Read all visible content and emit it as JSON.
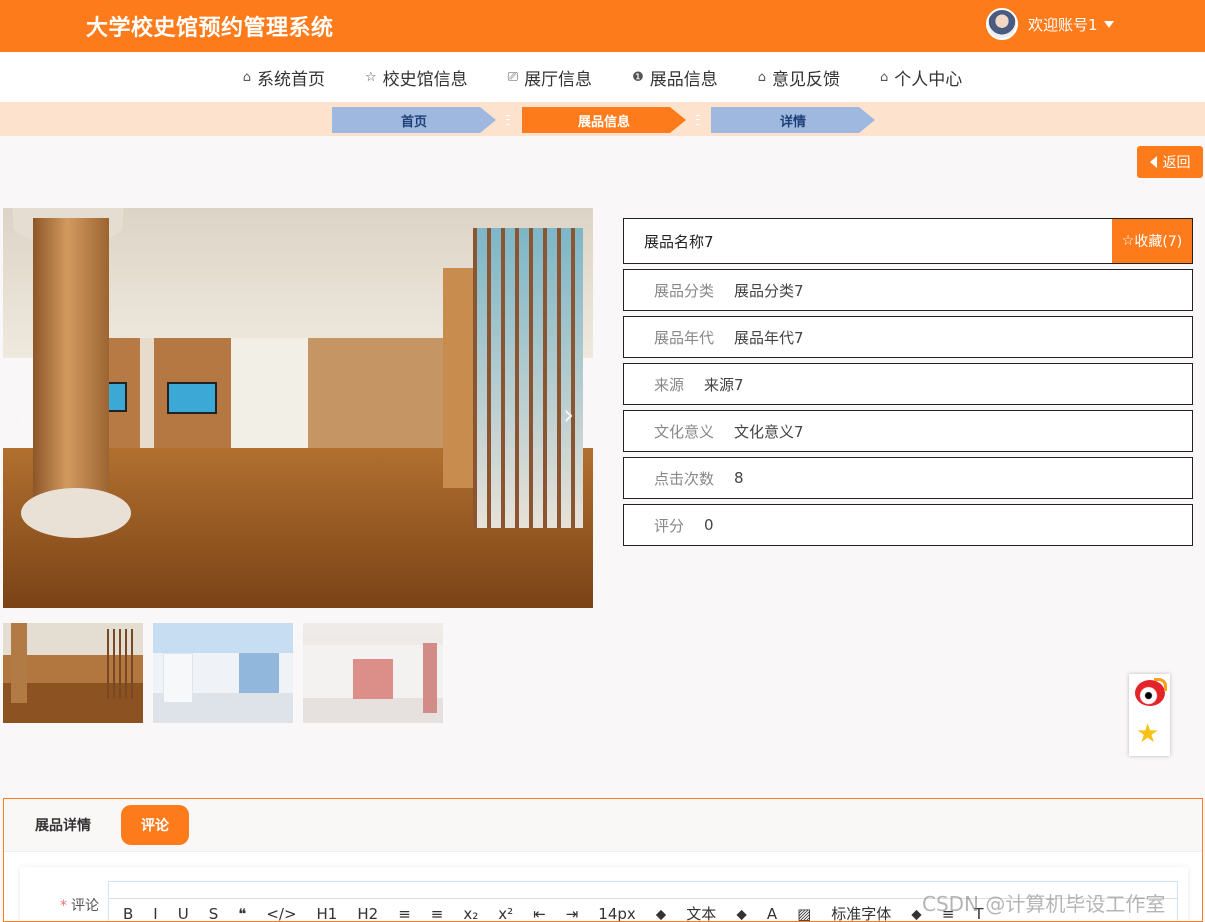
{
  "header": {
    "title": "大学校史馆预约管理系统",
    "welcome": "欢迎账号1"
  },
  "nav": [
    {
      "icon": "home-icon",
      "glyph": "⌂",
      "label": "系统首页"
    },
    {
      "icon": "star-icon",
      "glyph": "☆",
      "label": "校史馆信息"
    },
    {
      "icon": "bag-icon",
      "glyph": "⎚",
      "label": "展厅信息"
    },
    {
      "icon": "info-icon",
      "glyph": "❶",
      "label": "展品信息"
    },
    {
      "icon": "home-icon",
      "glyph": "⌂",
      "label": "意见反馈"
    },
    {
      "icon": "home-icon",
      "glyph": "⌂",
      "label": "个人中心"
    }
  ],
  "breadcrumb": [
    "首页",
    "展品信息",
    "详情"
  ],
  "back_label": "返回",
  "carousel": {
    "prev": "‹",
    "next": "›"
  },
  "exhibit": {
    "name": "展品名称7",
    "favorite_label": "收藏(7)",
    "fields": [
      {
        "label": "展品分类",
        "value": "展品分类7"
      },
      {
        "label": "展品年代",
        "value": "展品年代7"
      },
      {
        "label": "来源",
        "value": "来源7"
      },
      {
        "label": "文化意义",
        "value": "文化意义7"
      },
      {
        "label": "点击次数",
        "value": "8"
      },
      {
        "label": "评分",
        "value": "0"
      }
    ]
  },
  "tabs": {
    "detail": "展品详情",
    "comment": "评论"
  },
  "comment_form": {
    "required_mark": "*",
    "label": "评论",
    "toolbar": [
      "B",
      "I",
      "U",
      "S",
      "❝",
      "</>",
      "H1",
      "H2",
      "≡",
      "≡",
      "x₂",
      "x²",
      "⇤",
      "⇥",
      "14px",
      "⬥",
      "文本",
      "⬥",
      "A",
      "▨",
      "标准字体",
      "⬥",
      "≡",
      "T"
    ]
  },
  "watermark": "CSDN @计算机毕设工作室",
  "colors": {
    "accent": "#fe7b1c",
    "breadcrumb_inactive": "#9fb8e0",
    "breadcrumb_bar": "#fde2cd"
  }
}
